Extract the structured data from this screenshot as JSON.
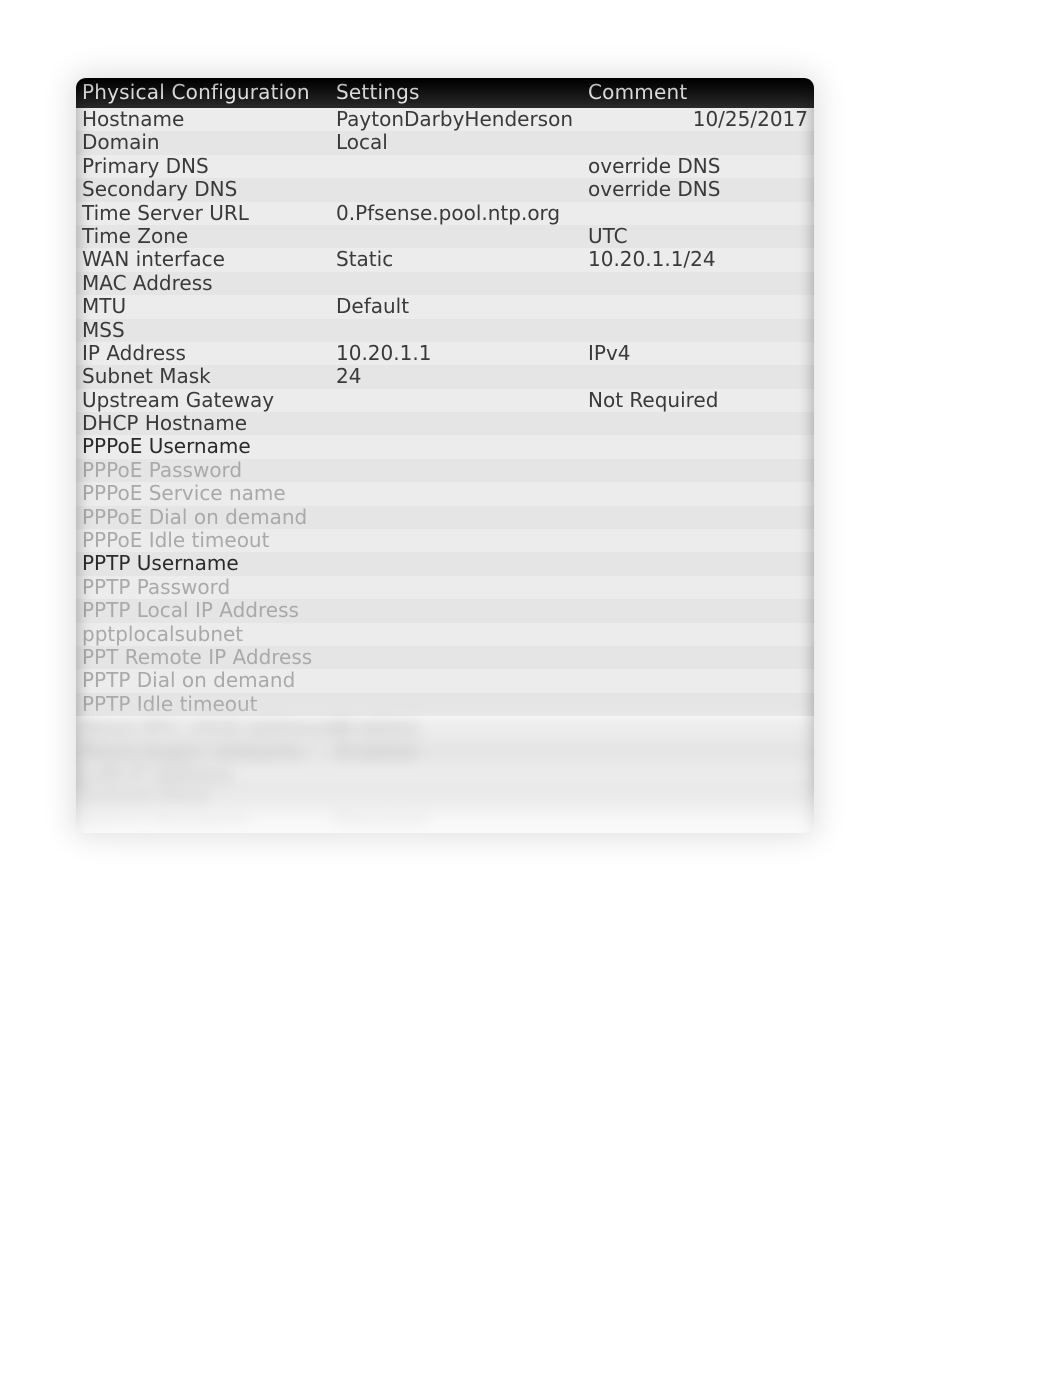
{
  "headers": {
    "col1": "Physical Configuration",
    "col2": "Settings",
    "col3": "Comment"
  },
  "rows": [
    {
      "label": "Hostname",
      "setting": "PaytonDarbyHenderson",
      "comment": "10/25/2017",
      "comment_align": "right"
    },
    {
      "label": "Domain",
      "setting": "Local",
      "comment": ""
    },
    {
      "label": "Primary DNS",
      "setting": "",
      "comment": "override DNS"
    },
    {
      "label": "Secondary DNS",
      "setting": "",
      "comment": "override DNS"
    },
    {
      "label": "Time Server URL",
      "setting": "0.Pfsense.pool.ntp.org",
      "comment": ""
    },
    {
      "label": "Time Zone",
      "setting": "",
      "comment": "UTC"
    },
    {
      "label": "WAN interface",
      "setting": "Static",
      "comment": "10.20.1.1/24"
    },
    {
      "label": "MAC Address",
      "setting": "",
      "comment": ""
    },
    {
      "label": "MTU",
      "setting": "Default",
      "comment": ""
    },
    {
      "label": "MSS",
      "setting": "",
      "comment": ""
    },
    {
      "label": "IP Address",
      "setting": "10.20.1.1",
      "comment": "IPv4"
    },
    {
      "label": "Subnet Mask",
      "setting": "24",
      "comment": ""
    },
    {
      "label": "Upstream Gateway",
      "setting": "",
      "comment": "Not Required"
    },
    {
      "label": "DHCP Hostname",
      "setting": "",
      "comment": ""
    },
    {
      "label": "PPPoE Username",
      "setting": "",
      "comment": "",
      "bold": true
    },
    {
      "label": "PPPoE Password",
      "setting": "",
      "comment": "",
      "muted": true
    },
    {
      "label": "PPPoE Service name",
      "setting": "",
      "comment": "",
      "muted": true
    },
    {
      "label": "PPPoE Dial on demand",
      "setting": "",
      "comment": "",
      "muted": true
    },
    {
      "label": "PPPoE Idle timeout",
      "setting": "",
      "comment": "",
      "muted": true
    },
    {
      "label": "PPTP Username",
      "setting": "",
      "comment": "",
      "bold": true
    },
    {
      "label": "PPTP Password",
      "setting": "",
      "comment": "",
      "muted": true
    },
    {
      "label": "PPTP Local IP Address",
      "setting": "",
      "comment": "",
      "muted": true
    },
    {
      "label": "pptplocalsubnet",
      "setting": "",
      "comment": "",
      "muted": true
    },
    {
      "label": "PPT Remote IP Address",
      "setting": "",
      "comment": "",
      "muted": true
    },
    {
      "label": "PPTP Dial on demand",
      "setting": "",
      "comment": "",
      "muted": true
    },
    {
      "label": "PPTP Idle timeout",
      "setting": "",
      "comment": "",
      "muted": true
    }
  ],
  "blurred_rows": [
    {
      "label": "Block RFC 1918 addresses",
      "setting": "Enabled",
      "comment": ""
    },
    {
      "label": "Block bogon networks",
      "setting": "Enabled",
      "comment": ""
    },
    {
      "label": "LAN IP Address",
      "setting": "",
      "comment": ""
    },
    {
      "label": "Subnet Mask",
      "setting": "",
      "comment": ""
    },
    {
      "label": "Admin Password",
      "setting": "Required",
      "comment": ""
    }
  ]
}
